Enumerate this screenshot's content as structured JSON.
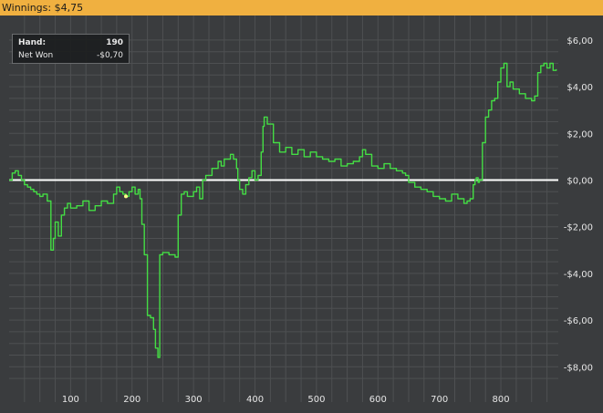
{
  "header": {
    "winnings_text": "Winnings: $4,75"
  },
  "tooltip": {
    "hand_label": "Hand:",
    "hand_value": "190",
    "netwon_label": "Net Won",
    "netwon_value": "-$0,70"
  },
  "colors": {
    "background": "#3a3c3e",
    "grid": "#4e5052",
    "line": "#44dd44",
    "zero_line": "#ffffff",
    "title_bar": "#f0b040",
    "marker": "#ffff88"
  },
  "chart_data": {
    "type": "line",
    "title": "Winnings: $4,75",
    "xlabel": "",
    "ylabel": "",
    "xlim": [
      0,
      895
    ],
    "ylim": [
      -8.8,
      6.2
    ],
    "x_ticks": [
      100,
      200,
      300,
      400,
      500,
      600,
      700,
      800
    ],
    "x_tick_labels": [
      "100",
      "200",
      "300",
      "400",
      "500",
      "600",
      "700",
      "800"
    ],
    "y_ticks": [
      6,
      4,
      2,
      0,
      -2,
      -4,
      -6,
      -8
    ],
    "y_tick_labels": [
      "$6,00",
      "$4,00",
      "$2,00",
      "$0,00",
      "-$2,00",
      "-$4,00",
      "-$6,00",
      "-$8,00"
    ],
    "grid": true,
    "zero_line": true,
    "highlight_point": {
      "x": 190,
      "y": -0.7
    },
    "x": [
      0,
      5,
      10,
      15,
      20,
      25,
      30,
      35,
      40,
      45,
      50,
      55,
      62,
      68,
      72,
      75,
      80,
      85,
      90,
      95,
      100,
      110,
      120,
      130,
      140,
      150,
      160,
      170,
      175,
      180,
      185,
      190,
      195,
      200,
      205,
      210,
      213,
      216,
      220,
      225,
      230,
      235,
      238,
      242,
      245,
      250,
      260,
      270,
      275,
      280,
      285,
      290,
      300,
      305,
      310,
      315,
      320,
      330,
      340,
      345,
      350,
      360,
      365,
      370,
      372,
      375,
      380,
      385,
      390,
      395,
      400,
      405,
      410,
      413,
      415,
      420,
      430,
      440,
      450,
      460,
      470,
      480,
      490,
      500,
      510,
      520,
      530,
      540,
      550,
      560,
      570,
      575,
      580,
      590,
      600,
      610,
      620,
      630,
      640,
      645,
      650,
      660,
      670,
      680,
      690,
      700,
      710,
      720,
      730,
      740,
      745,
      750,
      755,
      758,
      760,
      763,
      765,
      770,
      775,
      780,
      785,
      790,
      795,
      800,
      805,
      810,
      815,
      820,
      830,
      840,
      850,
      855,
      860,
      865,
      870,
      875,
      880,
      885,
      890
    ],
    "y": [
      0.0,
      0.3,
      0.4,
      0.2,
      0.0,
      -0.2,
      -0.3,
      -0.4,
      -0.5,
      -0.6,
      -0.7,
      -0.6,
      -0.9,
      -3.0,
      -2.5,
      -1.8,
      -2.4,
      -1.5,
      -1.2,
      -1.0,
      -1.2,
      -1.1,
      -0.9,
      -1.3,
      -1.1,
      -0.9,
      -1.0,
      -0.6,
      -0.3,
      -0.5,
      -0.6,
      -0.7,
      -0.5,
      -0.3,
      -0.6,
      -0.4,
      -0.8,
      -1.9,
      -3.2,
      -5.8,
      -5.9,
      -6.4,
      -7.2,
      -7.6,
      -3.2,
      -3.1,
      -3.2,
      -3.3,
      -1.5,
      -0.6,
      -0.5,
      -0.7,
      -0.5,
      -0.3,
      -0.8,
      0.0,
      0.2,
      0.5,
      0.8,
      0.6,
      0.9,
      1.1,
      0.9,
      0.5,
      0.0,
      -0.4,
      -0.6,
      -0.2,
      0.1,
      0.4,
      0.0,
      0.2,
      1.2,
      2.3,
      2.7,
      2.4,
      1.6,
      1.2,
      1.4,
      1.1,
      1.3,
      1.0,
      1.2,
      1.0,
      0.9,
      0.8,
      0.9,
      0.6,
      0.7,
      0.8,
      1.0,
      1.3,
      1.1,
      0.6,
      0.5,
      0.7,
      0.5,
      0.4,
      0.3,
      0.2,
      -0.1,
      -0.3,
      -0.4,
      -0.5,
      -0.7,
      -0.8,
      -0.9,
      -0.6,
      -0.8,
      -1.0,
      -0.9,
      -0.8,
      -0.2,
      0.0,
      0.1,
      -0.1,
      0.0,
      1.6,
      2.7,
      3.0,
      3.4,
      3.5,
      4.2,
      4.8,
      5.0,
      4.0,
      4.2,
      3.9,
      3.7,
      3.5,
      3.4,
      3.6,
      4.6,
      4.9,
      5.0,
      4.8,
      5.0,
      4.7,
      4.75
    ]
  }
}
